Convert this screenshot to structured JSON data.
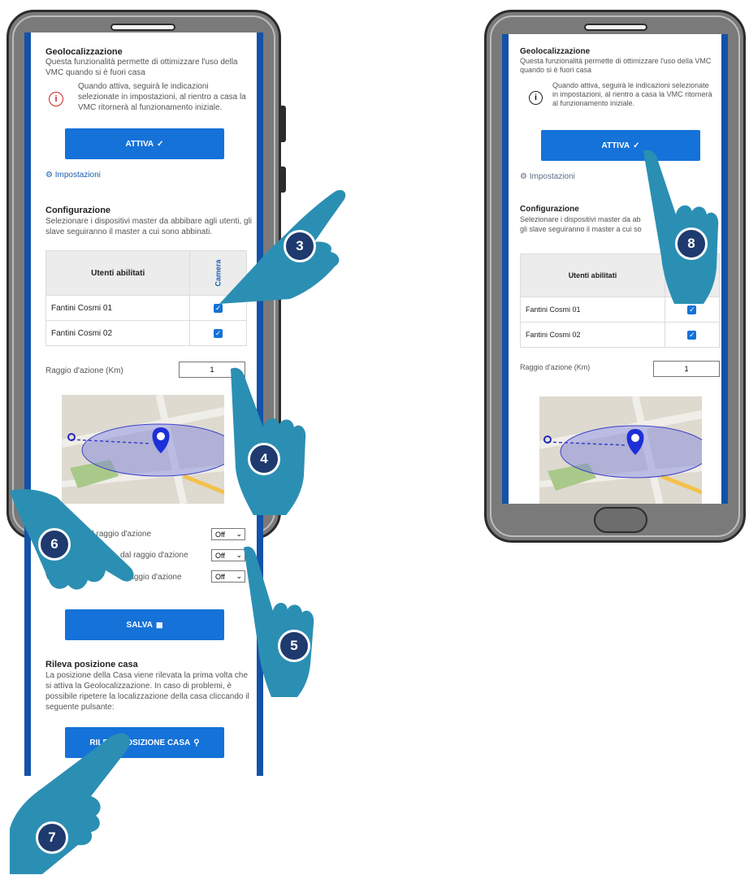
{
  "left_phone": {
    "geo_title": "Geolocalizzazione",
    "geo_desc": "Questa funzionalità permette di ottimizzare l'uso della VMC quando si è fuori casa",
    "info_icon_glyph": "i",
    "info_text": "Quando attiva, seguirà le indicazioni selezionate in impostazioni, al rientro a casa la VMC ritornerà al funzionamento iniziale.",
    "activate_label": "ATTIVA",
    "activate_icon": "check-circle-icon",
    "settings_link": "Impostazioni",
    "config_title": "Configurazione",
    "config_desc": "Selezionare i dispositivi master da abbibare agli utenti, gli slave seguiranno il master a cui sono abbinati.",
    "table_header_users": "Utenti abilitati",
    "table_header_room": "Camera",
    "rows": [
      "Fantini Cosmi 01",
      "Fantini Cosmi 02"
    ],
    "radius_label": "Raggio d'azione (Km)",
    "radius_value": "1",
    "rule_1": "All'interno del raggio d'azione",
    "rule_2": "dal raggio d'azione",
    "rule_3": "raggio d'azione",
    "rule_prefix_3": "V",
    "select_value": "Off",
    "save_label": "SALVA",
    "home_title": "Rileva posizione casa",
    "home_desc": "La posizione della Casa viene rilevata la prima volta che si attiva la Geolocalizzazione. In caso di problemi, è possibile ripetere la localizzazione della casa cliccando il seguente pulsante:",
    "home_button": "RILEVA POSIZIONE CASA"
  },
  "right_phone": {
    "geo_title": "Geolocalizzazione",
    "geo_desc": "Questa funzionalità permette di ottimizzare l'uso della VMC quando si è fuori casa",
    "info_text": "Quando attiva, seguirà le indicazioni selezionate in impostazioni, al rientro a casa la VMC ritornerà al funzionamento iniziale.",
    "activate_label": "ATTIVA",
    "settings_link": "Impostazioni",
    "config_title": "Configurazione",
    "config_desc_1": "Selezionare i dispositivi master da ab",
    "config_desc_2": "gli slave seguiranno il master a cui so",
    "table_header_users": "Utenti abilitati",
    "rows": [
      "Fantini Cosmi 01",
      "Fantini Cosmi 02"
    ],
    "radius_label": "Raggio d'azione (Km)",
    "radius_value": "1"
  },
  "steps": [
    "3",
    "4",
    "5",
    "6",
    "7",
    "8"
  ],
  "colors": {
    "accent": "#1572d8",
    "frame": "#1352a8",
    "hand": "#2b8fb3",
    "badge": "#1e3a6e"
  }
}
